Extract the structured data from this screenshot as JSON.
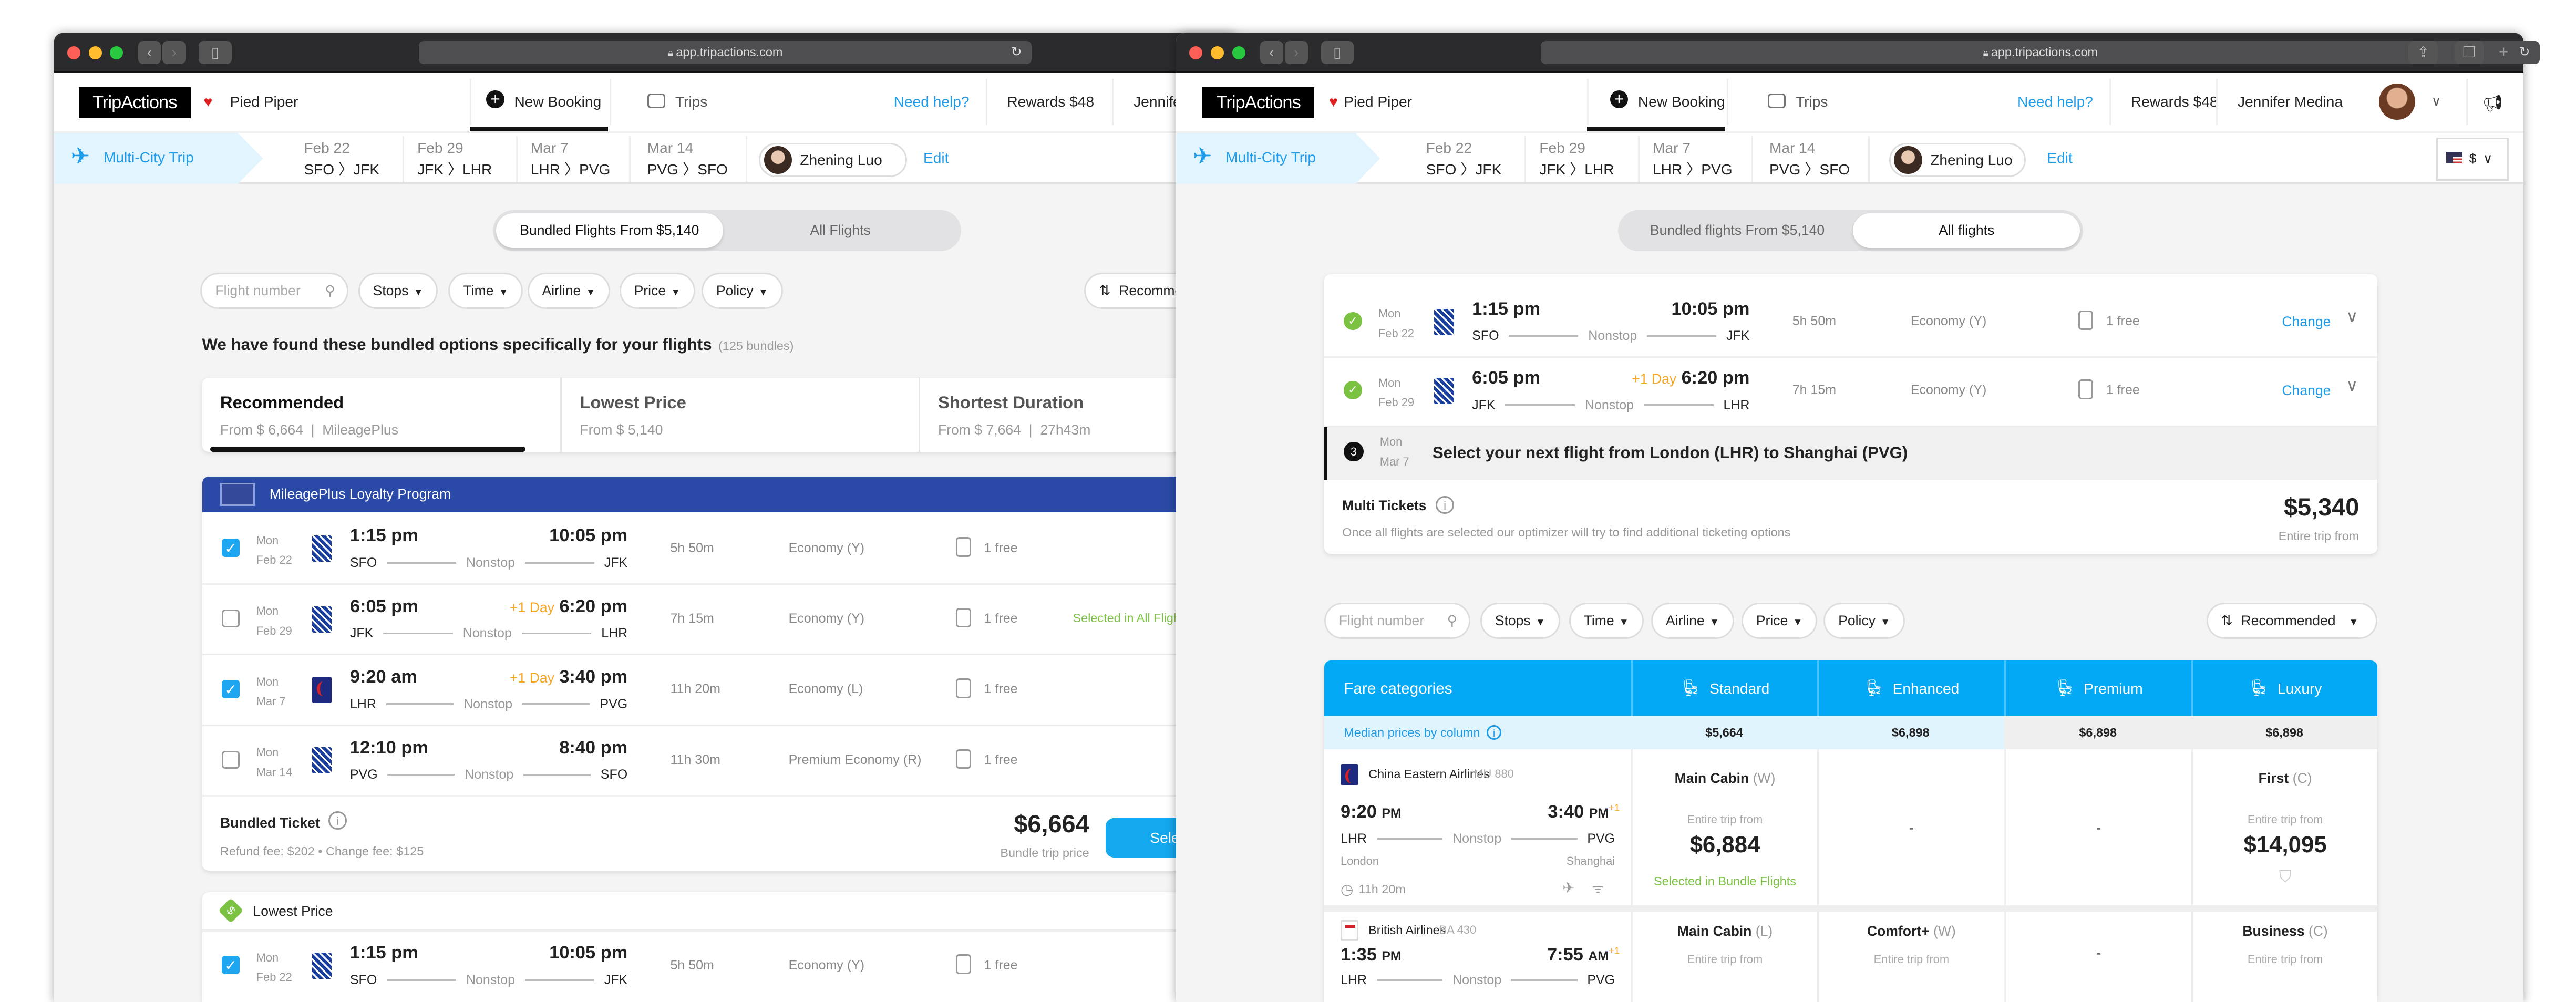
{
  "browser": {
    "url": "app.tripactions.com"
  },
  "header": {
    "logo": "TripActions",
    "company": "Pied Piper",
    "new_booking": "New Booking",
    "trips": "Trips",
    "help": "Need help?",
    "rewards": "Rewards",
    "rewards_amount": "$48",
    "user": "Jennifer Medina"
  },
  "trip": {
    "type": "Multi-City Trip",
    "legs": [
      {
        "date": "Feb 22",
        "route": "SFO 〉JFK"
      },
      {
        "date": "Feb 29",
        "route": "JFK 〉LHR"
      },
      {
        "date": "Mar 7",
        "route": "LHR 〉PVG"
      },
      {
        "date": "Mar 14",
        "route": "PVG 〉SFO"
      }
    ],
    "traveler": "Zhening Luo",
    "edit": "Edit",
    "currency": "$"
  },
  "filters": {
    "placeholder": "Flight number",
    "items": [
      "Stops",
      "Time",
      "Airline",
      "Price",
      "Policy"
    ],
    "sort": "Recommended"
  },
  "colors": {
    "accent": "#1e9be9",
    "table_header": "#03a9f4",
    "program": "#2b4aa7",
    "success": "#7cc242",
    "warning": "#f5a623"
  },
  "left": {
    "toggle": {
      "bundled": "Bundled Flights From $5,140",
      "all": "All Flights",
      "active": "bundled"
    },
    "heading": "We have found these bundled options specifically for your flights",
    "count": "(125 bundles)",
    "tabs": [
      {
        "title": "Recommended",
        "sub": "From $ 6,664  |  MileagePlus",
        "active": true
      },
      {
        "title": "Lowest Price",
        "sub": "From $ 5,140"
      },
      {
        "title": "Shortest Duration",
        "sub": "From $ 7,664  |  27h43m"
      }
    ],
    "bundle": {
      "program": "MileagePlus Loyalty Program",
      "program_logo": "MileagePlus",
      "flights": [
        {
          "checked": true,
          "day": "Mon",
          "date": "Feb 22",
          "airline": "united",
          "dep": "1:15 pm",
          "plus": "",
          "arr": "10:05 pm",
          "from": "SFO",
          "to": "JFK",
          "stops": "Nonstop",
          "duration": "5h 50m",
          "cabin": "Economy (Y)",
          "bags": "1 free",
          "note": ""
        },
        {
          "checked": false,
          "day": "Mon",
          "date": "Feb 29",
          "airline": "united",
          "dep": "6:05 pm",
          "plus": "+1 Day",
          "arr": "6:20 pm",
          "from": "JFK",
          "to": "LHR",
          "stops": "Nonstop",
          "duration": "7h 15m",
          "cabin": "Economy (Y)",
          "bags": "1 free",
          "note": "Selected in All Flights"
        },
        {
          "checked": true,
          "day": "Mon",
          "date": "Mar 7",
          "airline": "china",
          "dep": "9:20 am",
          "plus": "+1 Day",
          "arr": "3:40 pm",
          "from": "LHR",
          "to": "PVG",
          "stops": "Nonstop",
          "duration": "11h 20m",
          "cabin": "Economy (L)",
          "bags": "1 free",
          "note": ""
        },
        {
          "checked": false,
          "day": "Mon",
          "date": "Mar 14",
          "airline": "united",
          "dep": "12:10 pm",
          "plus": "",
          "arr": "8:40 pm",
          "from": "PVG",
          "to": "SFO",
          "stops": "Nonstop",
          "duration": "11h 30m",
          "cabin": "Premium Economy (R)",
          "bags": "1 free",
          "note": ""
        }
      ],
      "ticket_label": "Bundled Ticket",
      "fees": "Refund fee: $202 • Change fee: $125",
      "price": "$6,664",
      "price_label": "Bundle trip price",
      "select": "Select"
    },
    "bundle2": {
      "title": "Lowest Price",
      "flights": [
        {
          "checked": true,
          "day": "Mon",
          "date": "Feb 22",
          "airline": "united",
          "dep": "1:15 pm",
          "plus": "",
          "arr": "10:05 pm",
          "from": "SFO",
          "to": "JFK",
          "stops": "Nonstop",
          "duration": "5h 50m",
          "cabin": "Economy (Y)",
          "bags": "1 free",
          "note": ""
        }
      ]
    }
  },
  "right": {
    "toggle": {
      "bundled": "Bundled flights From $5,140",
      "all": "All flights",
      "active": "all"
    },
    "summary": {
      "flights": [
        {
          "day": "Mon",
          "date": "Feb 22",
          "airline": "united",
          "dep": "1:15 pm",
          "plus": "",
          "arr": "10:05 pm",
          "from": "SFO",
          "to": "JFK",
          "stops": "Nonstop",
          "duration": "5h 50m",
          "cabin": "Economy (Y)",
          "bags": "1 free",
          "change": "Change"
        },
        {
          "day": "Mon",
          "date": "Feb 29",
          "airline": "united",
          "dep": "6:05 pm",
          "plus": "+1 Day",
          "arr": "6:20 pm",
          "from": "JFK",
          "to": "LHR",
          "stops": "Nonstop",
          "duration": "7h 15m",
          "cabin": "Economy (Y)",
          "bags": "1 free",
          "change": "Change"
        }
      ],
      "step": {
        "number": "3",
        "day": "Mon",
        "date": "Mar 7",
        "text": "Select your next flight from London (LHR) to Shanghai (PVG)"
      },
      "multi": {
        "label": "Multi Tickets",
        "note": "Once all flights are selected our optimizer will try to find additional ticketing options",
        "price": "$5,340",
        "price_label": "Entire trip from"
      }
    },
    "fare_table": {
      "title": "Fare categories",
      "columns": [
        "Standard",
        "Enhanced",
        "Premium",
        "Luxury"
      ],
      "median_label": "Median prices by column",
      "medians": [
        "$5,664",
        "$6,898",
        "$6,898",
        "$6,898"
      ],
      "rows": [
        {
          "airline": "China Eastern Airlines",
          "logo": "china",
          "flight": "MU 880",
          "dep": "9:20",
          "dep_ampm": "PM",
          "arr": "3:40",
          "arr_ampm": "PM",
          "plus": "+1",
          "from": "LHR",
          "to": "PVG",
          "stops": "Nonstop",
          "from_city": "London",
          "to_city": "Shanghai",
          "duration": "11h 20m",
          "fares": [
            {
              "name": "Main Cabin",
              "code": "(W)",
              "label": "Entire trip from",
              "price": "$6,884",
              "note": "Selected in Bundle Flights"
            },
            {
              "empty": "-"
            },
            {
              "empty": "-"
            },
            {
              "name": "First",
              "code": "(C)",
              "label": "Entire trip from",
              "price": "$14,095"
            }
          ]
        },
        {
          "airline": "British Airlines",
          "logo": "ba",
          "flight": "BA 430",
          "dep": "1:35",
          "dep_ampm": "PM",
          "arr": "7:55",
          "arr_ampm": "AM",
          "plus": "+1",
          "from": "LHR",
          "to": "PVG",
          "stops": "Nonstop",
          "fares": [
            {
              "name": "Main Cabin",
              "code": "(L)",
              "label": "Entire trip from"
            },
            {
              "name": "Comfort+",
              "code": "(W)",
              "label": "Entire trip from"
            },
            {
              "empty": "-"
            },
            {
              "name": "Business",
              "code": "(C)",
              "label": "Entire trip from"
            }
          ]
        }
      ]
    }
  }
}
